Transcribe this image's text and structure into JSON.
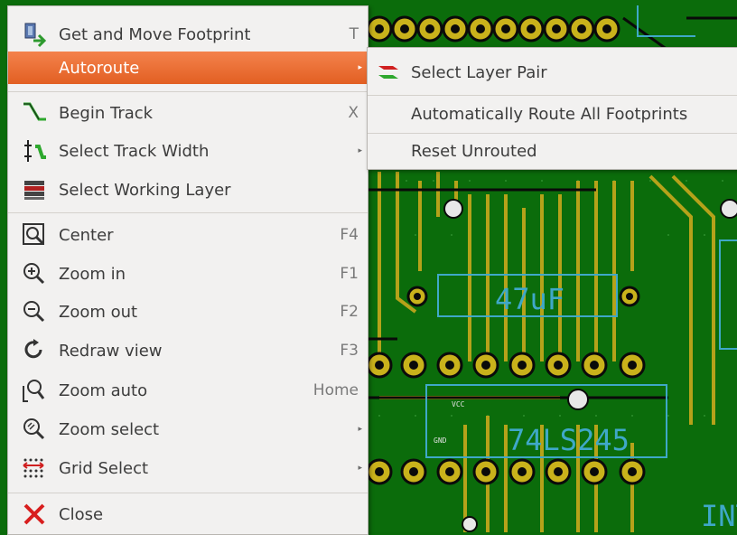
{
  "context_menu": {
    "items": [
      {
        "label": "Get and Move Footprint",
        "shortcut": "T",
        "icon": "move-footprint-icon"
      },
      {
        "label": "Autoroute",
        "submenu": true,
        "active": true
      },
      {
        "label": "Begin Track",
        "shortcut": "X",
        "icon": "track-icon"
      },
      {
        "label": "Select Track Width",
        "submenu": true,
        "icon": "track-width-icon"
      },
      {
        "label": "Select Working Layer",
        "icon": "layers-icon"
      },
      {
        "label": "Center",
        "shortcut": "F4",
        "icon": "center-icon"
      },
      {
        "label": "Zoom in",
        "shortcut": "F1",
        "icon": "zoom-in-icon"
      },
      {
        "label": "Zoom out",
        "shortcut": "F2",
        "icon": "zoom-out-icon"
      },
      {
        "label": "Redraw view",
        "shortcut": "F3",
        "icon": "redraw-icon"
      },
      {
        "label": "Zoom auto",
        "shortcut": "Home",
        "icon": "zoom-auto-icon"
      },
      {
        "label": "Zoom select",
        "submenu": true,
        "icon": "zoom-select-icon"
      },
      {
        "label": "Grid Select",
        "submenu": true,
        "icon": "grid-icon"
      },
      {
        "label": "Close",
        "icon": "close-icon"
      }
    ]
  },
  "autoroute_submenu": {
    "items": [
      {
        "label": "Select Layer Pair",
        "icon": "layer-pair-icon"
      },
      {
        "label": "Automatically Route All Footprints"
      },
      {
        "label": "Reset Unrouted"
      }
    ]
  },
  "pcb": {
    "component_labels": [
      "47uF",
      "74LS245",
      "INT"
    ],
    "net_labels": [
      "VCC",
      "GND"
    ]
  },
  "colors": {
    "board": "#0a6a0a",
    "track": "#b5a21a",
    "component_outline": "#3fa8c8",
    "menu_highlight": "#e8662a"
  }
}
